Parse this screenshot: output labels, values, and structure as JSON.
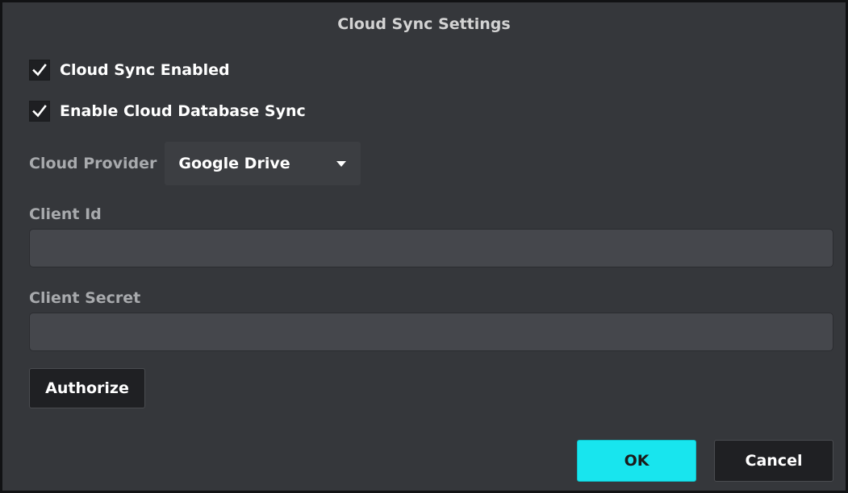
{
  "dialog": {
    "title": "Cloud Sync Settings"
  },
  "options": {
    "cloud_sync_enabled": {
      "label": "Cloud Sync Enabled",
      "checked": true
    },
    "cloud_db_sync": {
      "label": "Enable Cloud Database Sync",
      "checked": true
    }
  },
  "provider": {
    "label": "Cloud Provider",
    "selected": "Google Drive"
  },
  "client_id": {
    "label": "Client Id",
    "value": ""
  },
  "client_secret": {
    "label": "Client Secret",
    "value": ""
  },
  "buttons": {
    "authorize": "Authorize",
    "ok": "OK",
    "cancel": "Cancel"
  },
  "colors": {
    "background": "#35373b",
    "accent": "#18e5ee",
    "input_bg": "#45474c",
    "muted_label": "#a8aaad"
  },
  "icons": {
    "checkbox_mark": "check-icon",
    "dropdown": "chevron-down-icon"
  }
}
